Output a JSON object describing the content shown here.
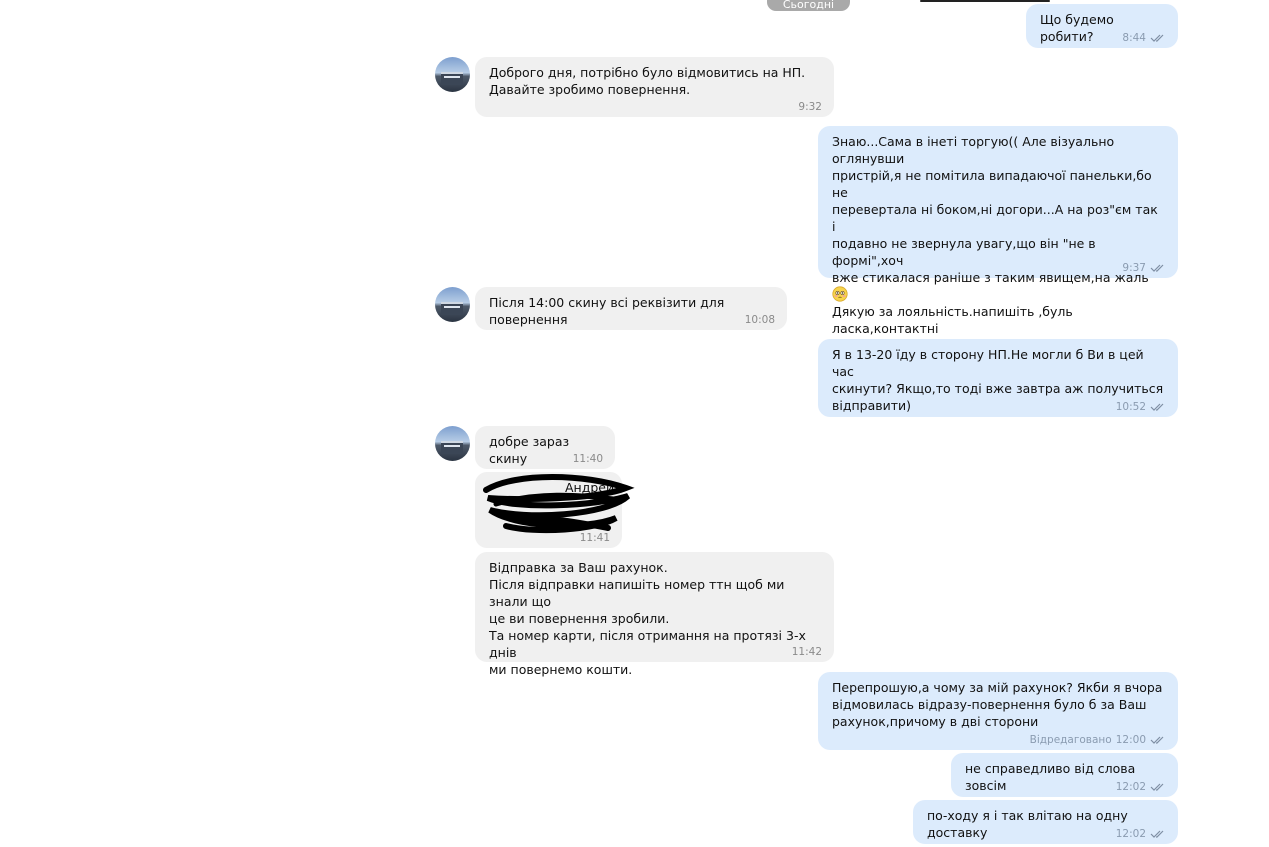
{
  "date_label": "Сьогодні",
  "messages": [
    {
      "text": "Що будемо робити?",
      "time": "8:44",
      "edited": ""
    },
    {
      "text": "Доброго дня, потрібно було відмовитись на НП.\nДавайте зробимо повернення.",
      "time": "9:32"
    },
    {
      "text_a": "Знаю...Сама в інеті торгую(( Але візуально оглянувши\nпристрій,я не помітила випадаючої панельки,бо не\nперевертала ні боком,ні догори...А на роз\"єм так і\nподавно не звернула увагу,що він \"не в формі\",хоч\nвже стикалася раніше з таким явищем,на жаль",
      "emoji": "flushed-face",
      "text_b": "Дякую за лояльність.напишіть ,буль ласка,контактні\nдані для відправки.",
      "time": "9:37"
    },
    {
      "text": "Після 14:00 скину всі реквізити для повернення",
      "time": "10:08"
    },
    {
      "text": "Я в 13-20 їду в сторону НП.Не могли б Ви в цей час\nскинути? Якщо,то тоді вже завтра аж получиться\nвідправити)",
      "time": "10:52"
    },
    {
      "text": "добре зараз скину",
      "time": "11:40"
    },
    {
      "text": "Андрей",
      "time": "11:41",
      "redacted": true
    },
    {
      "text": "Відправка за Ваш рахунок.\nПісля відправки напишіть номер ттн щоб ми знали що\nце ви повернення зробили.\nТа номер карти, після отримання на протязі 3-х днів\nми повернемо кошти.",
      "time": "11:42"
    },
    {
      "text": "Перепрошую,а чому за мій рахунок? Якби я вчора\nвідмовилась відразу-повернення було б за Ваш\nрахунок,причому в дві сторони",
      "time": "12:00",
      "edited": "Відредаговано"
    },
    {
      "text": "не справедливо від слова зовсім",
      "time": "12:02"
    },
    {
      "text": "по-ходу я і так влітаю на одну доставку",
      "time": "12:02"
    }
  ]
}
